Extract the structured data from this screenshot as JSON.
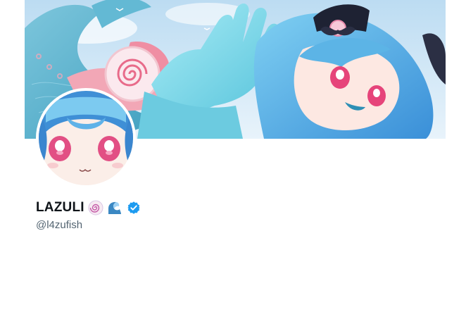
{
  "profile": {
    "display_name": "LAZULI",
    "handle": "@l4zufish",
    "verified": true,
    "name_emojis": [
      "swirl-candy-emoji",
      "wave-emoji"
    ]
  },
  "colors": {
    "name_text": "#0f1419",
    "handle_text": "#536471",
    "verified_badge": "#1d9bf0",
    "background": "#ffffff"
  },
  "banner": {
    "icon": "banner-image"
  },
  "avatar": {
    "icon": "avatar-image"
  }
}
